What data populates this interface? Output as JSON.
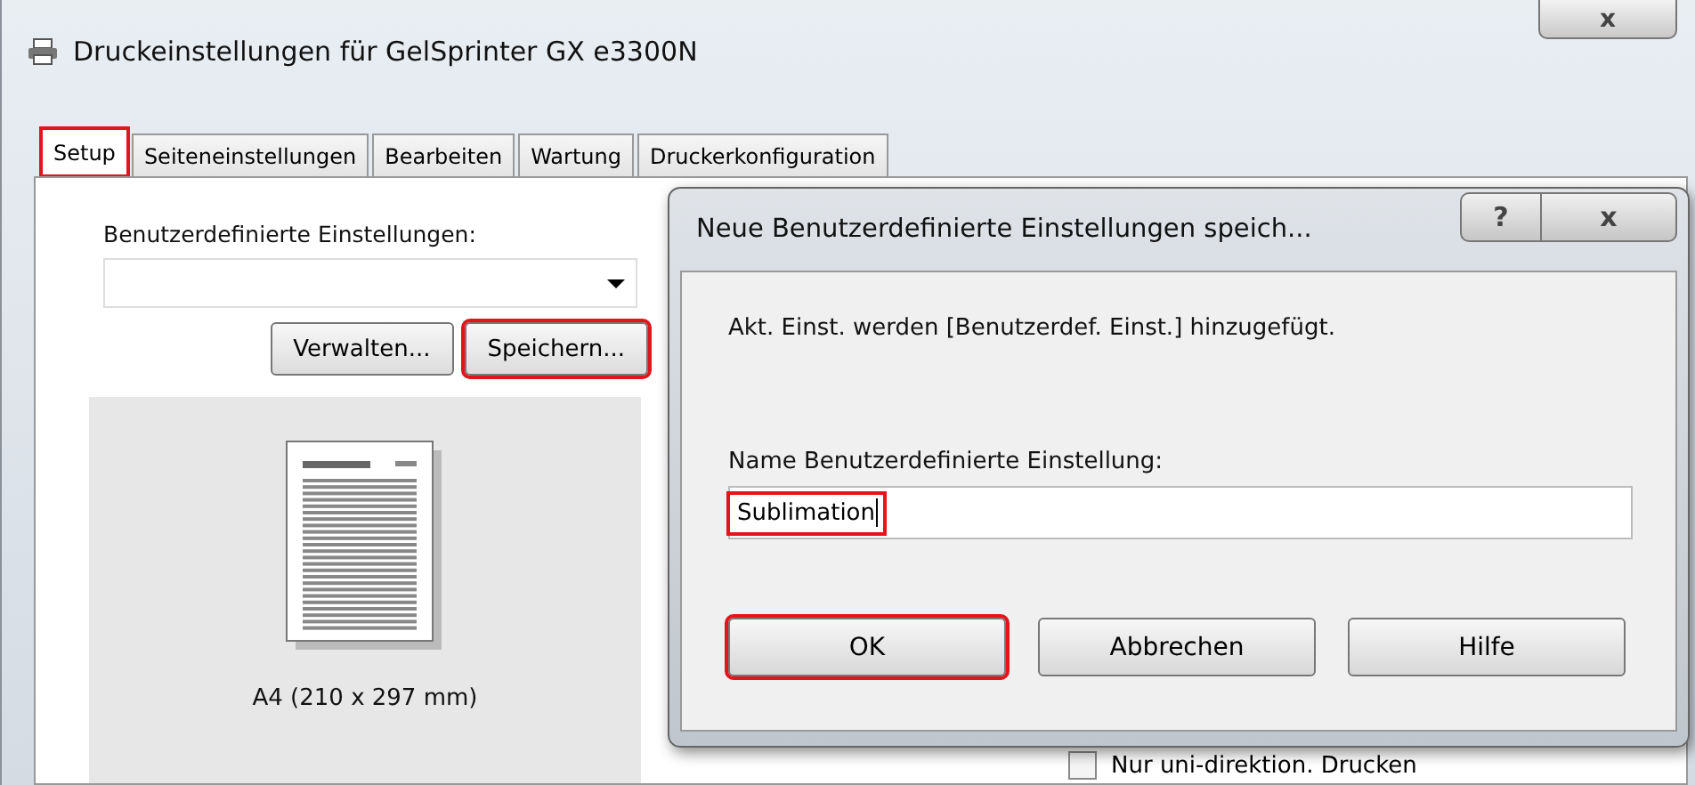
{
  "window": {
    "title": "Druckeinstellungen für GelSprinter GX e3300N",
    "close": "x"
  },
  "tabs": [
    {
      "label": "Setup",
      "selected": true,
      "highlighted": true
    },
    {
      "label": "Seiteneinstellungen",
      "selected": false,
      "highlighted": false
    },
    {
      "label": "Bearbeiten",
      "selected": false,
      "highlighted": false
    },
    {
      "label": "Wartung",
      "selected": false,
      "highlighted": false
    },
    {
      "label": "Druckerkonfiguration",
      "selected": false,
      "highlighted": false
    }
  ],
  "custom_settings": {
    "label": "Benutzerdefinierte Einstellungen:",
    "buttons": [
      {
        "label": "Verwalten...",
        "highlighted": false
      },
      {
        "label": "Speichern...",
        "highlighted": true
      }
    ]
  },
  "preview": {
    "paper": "A4 (210 x 297 mm)"
  },
  "options": [
    {
      "label": "Nur uni-direktion. Drucken",
      "checked": false
    }
  ],
  "dialog": {
    "title": "Neue Benutzerdefinierte Einstellungen speich...",
    "help": "?",
    "close": "x",
    "message": "Akt. Einst. werden [Benutzerdef. Einst.] hinzugefügt.",
    "field_label": "Name Benutzerdefinierte Einstellung:",
    "value": "Sublimation",
    "value_highlighted": true,
    "buttons": [
      {
        "label": "OK",
        "highlighted": true
      },
      {
        "label": "Abbrechen",
        "highlighted": false
      },
      {
        "label": "Hilfe",
        "highlighted": false
      }
    ]
  }
}
